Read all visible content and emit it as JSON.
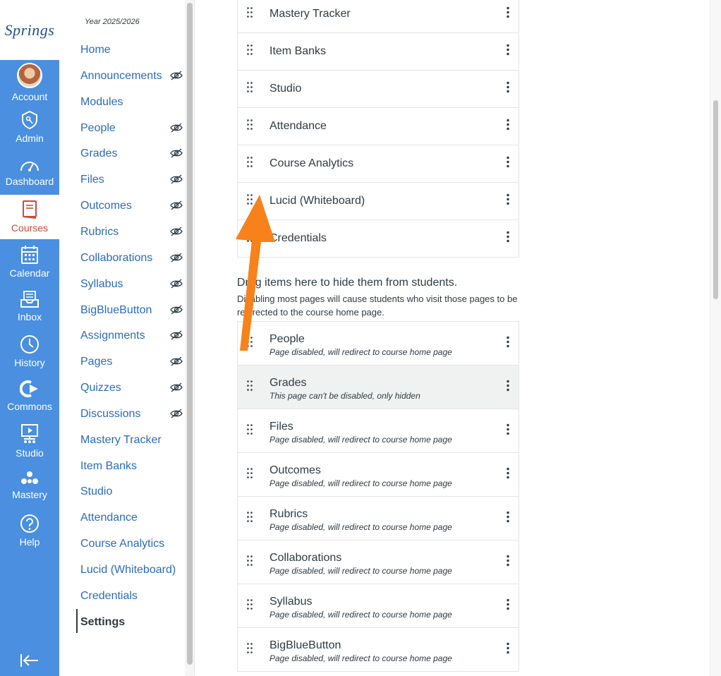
{
  "global_nav": {
    "logo_text": "Springs",
    "items": [
      {
        "label": "Account",
        "icon": "avatar"
      },
      {
        "label": "Admin",
        "icon": "admin-shield-icon"
      },
      {
        "label": "Dashboard",
        "icon": "dashboard-gauge-icon"
      },
      {
        "label": "Courses",
        "icon": "book-icon",
        "active": true
      },
      {
        "label": "Calendar",
        "icon": "calendar-icon"
      },
      {
        "label": "Inbox",
        "icon": "inbox-icon"
      },
      {
        "label": "History",
        "icon": "clock-icon"
      },
      {
        "label": "Commons",
        "icon": "commons-arrow-icon"
      },
      {
        "label": "Studio",
        "icon": "studio-icon"
      },
      {
        "label": "Mastery",
        "icon": "mastery-icon"
      },
      {
        "label": "Help",
        "icon": "help-icon"
      }
    ],
    "colors": {
      "nav_bg": "#4a8fe0",
      "active_icon": "#d0483a"
    }
  },
  "course_nav": {
    "year": "Year 2025/2026",
    "items": [
      {
        "label": "Home",
        "hidden": false
      },
      {
        "label": "Announcements",
        "hidden": true
      },
      {
        "label": "Modules",
        "hidden": false
      },
      {
        "label": "People",
        "hidden": true
      },
      {
        "label": "Grades",
        "hidden": true
      },
      {
        "label": "Files",
        "hidden": true
      },
      {
        "label": "Outcomes",
        "hidden": true
      },
      {
        "label": "Rubrics",
        "hidden": true
      },
      {
        "label": "Collaborations",
        "hidden": true
      },
      {
        "label": "Syllabus",
        "hidden": true
      },
      {
        "label": "BigBlueButton",
        "hidden": true
      },
      {
        "label": "Assignments",
        "hidden": true
      },
      {
        "label": "Pages",
        "hidden": true
      },
      {
        "label": "Quizzes",
        "hidden": true
      },
      {
        "label": "Discussions",
        "hidden": true
      },
      {
        "label": "Mastery Tracker",
        "hidden": false
      },
      {
        "label": "Item Banks",
        "hidden": false
      },
      {
        "label": "Studio",
        "hidden": false
      },
      {
        "label": "Attendance",
        "hidden": false
      },
      {
        "label": "Course Analytics",
        "hidden": false
      },
      {
        "label": "Lucid (Whiteboard)",
        "hidden": false
      },
      {
        "label": "Credentials",
        "hidden": false
      },
      {
        "label": "Settings",
        "hidden": false,
        "current": true
      }
    ],
    "link_color": "#2b6cb8"
  },
  "visible_items": [
    "Mastery Tracker",
    "Item Banks",
    "Studio",
    "Attendance",
    "Course Analytics",
    "Lucid (Whiteboard)",
    "Credentials"
  ],
  "hidden_section": {
    "title": "Drag items here to hide them from students.",
    "description": "Disabling most pages will cause students who visit those pages to be redirected to the course home page."
  },
  "hidden_items": [
    {
      "name": "People",
      "note": "Page disabled, will redirect to course home page"
    },
    {
      "name": "Grades",
      "note": "This page can't be disabled, only hidden",
      "highlighted": true
    },
    {
      "name": "Files",
      "note": "Page disabled, will redirect to course home page"
    },
    {
      "name": "Outcomes",
      "note": "Page disabled, will redirect to course home page"
    },
    {
      "name": "Rubrics",
      "note": "Page disabled, will redirect to course home page"
    },
    {
      "name": "Collaborations",
      "note": "Page disabled, will redirect to course home page"
    },
    {
      "name": "Syllabus",
      "note": "Page disabled, will redirect to course home page"
    },
    {
      "name": "BigBlueButton",
      "note": "Page disabled, will redirect to course home page"
    }
  ],
  "annotation": {
    "arrow_color": "#f7821b"
  }
}
